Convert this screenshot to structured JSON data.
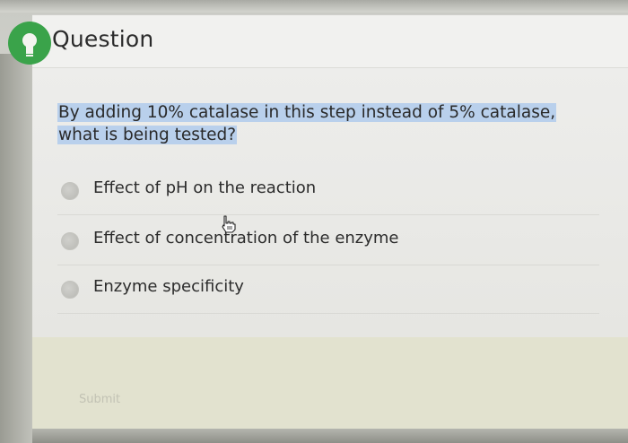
{
  "header": {
    "title": "Question",
    "icon": "lightbulb-icon",
    "icon_color": "#3aa34a"
  },
  "question": {
    "line1": "By adding 10% catalase in this step instead of 5% catalase,",
    "line2": "what is being tested?",
    "highlight_color": "#b9d0ec"
  },
  "options": [
    {
      "label": "Effect of pH on the reaction"
    },
    {
      "label": "Effect of concentration of the enzyme"
    },
    {
      "label": "Enzyme specificity"
    }
  ],
  "submit": {
    "label": "Submit"
  }
}
